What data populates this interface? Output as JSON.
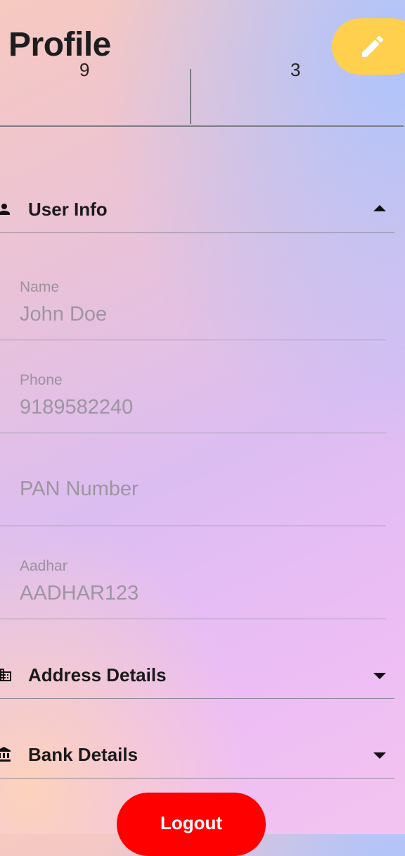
{
  "header": {
    "title": "Profile",
    "edit_icon": "pencil-icon"
  },
  "stats": {
    "left_value": "9",
    "right_value": "3"
  },
  "user_info": {
    "label": "User Info",
    "icon": "person-icon",
    "expanded": true,
    "fields": {
      "name": {
        "label": "Name",
        "value": "John Doe"
      },
      "phone": {
        "label": "Phone",
        "value": "9189582240"
      },
      "pan": {
        "placeholder": "PAN Number",
        "value": ""
      },
      "aadhar": {
        "label": "Aadhar",
        "value": "AADHAR123"
      }
    }
  },
  "address_details": {
    "label": "Address Details",
    "icon": "building-icon",
    "expanded": false
  },
  "bank_details": {
    "label": "Bank Details",
    "icon": "bank-icon",
    "expanded": false
  },
  "logout": {
    "label": "Logout"
  },
  "colors": {
    "accent_fab": "#ffd04d",
    "logout": "#ff0000"
  }
}
